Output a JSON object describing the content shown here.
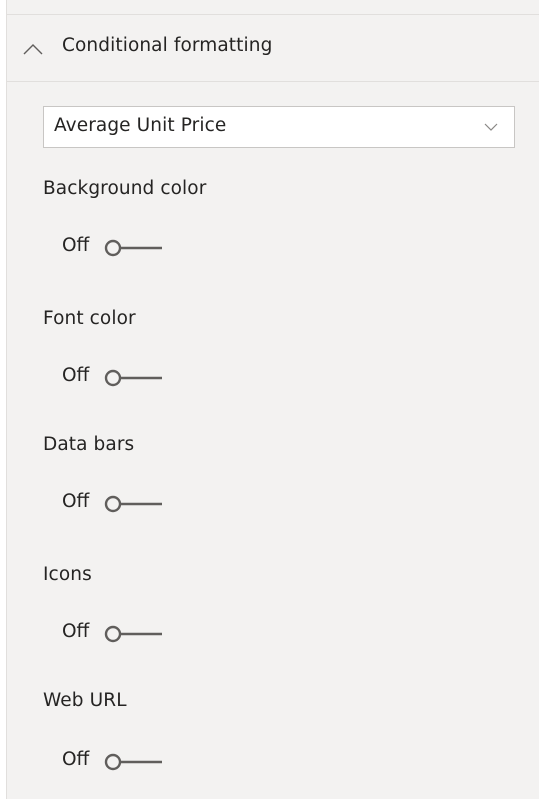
{
  "section": {
    "title": "Conditional formatting",
    "expanded": true
  },
  "field_dropdown": {
    "selected": "Average Unit Price"
  },
  "options": [
    {
      "label": "Background color",
      "state": "Off"
    },
    {
      "label": "Font color",
      "state": "Off"
    },
    {
      "label": "Data bars",
      "state": "Off"
    },
    {
      "label": "Icons",
      "state": "Off"
    },
    {
      "label": "Web URL",
      "state": "Off"
    }
  ],
  "icons": {
    "collapse": "chevron-up-icon",
    "dropdown": "chevron-down-icon",
    "toggle": "toggle-switch-icon"
  },
  "colors": {
    "panel_bg": "#f3f2f1",
    "text": "#252423",
    "toggle_off": "#605e5c"
  }
}
